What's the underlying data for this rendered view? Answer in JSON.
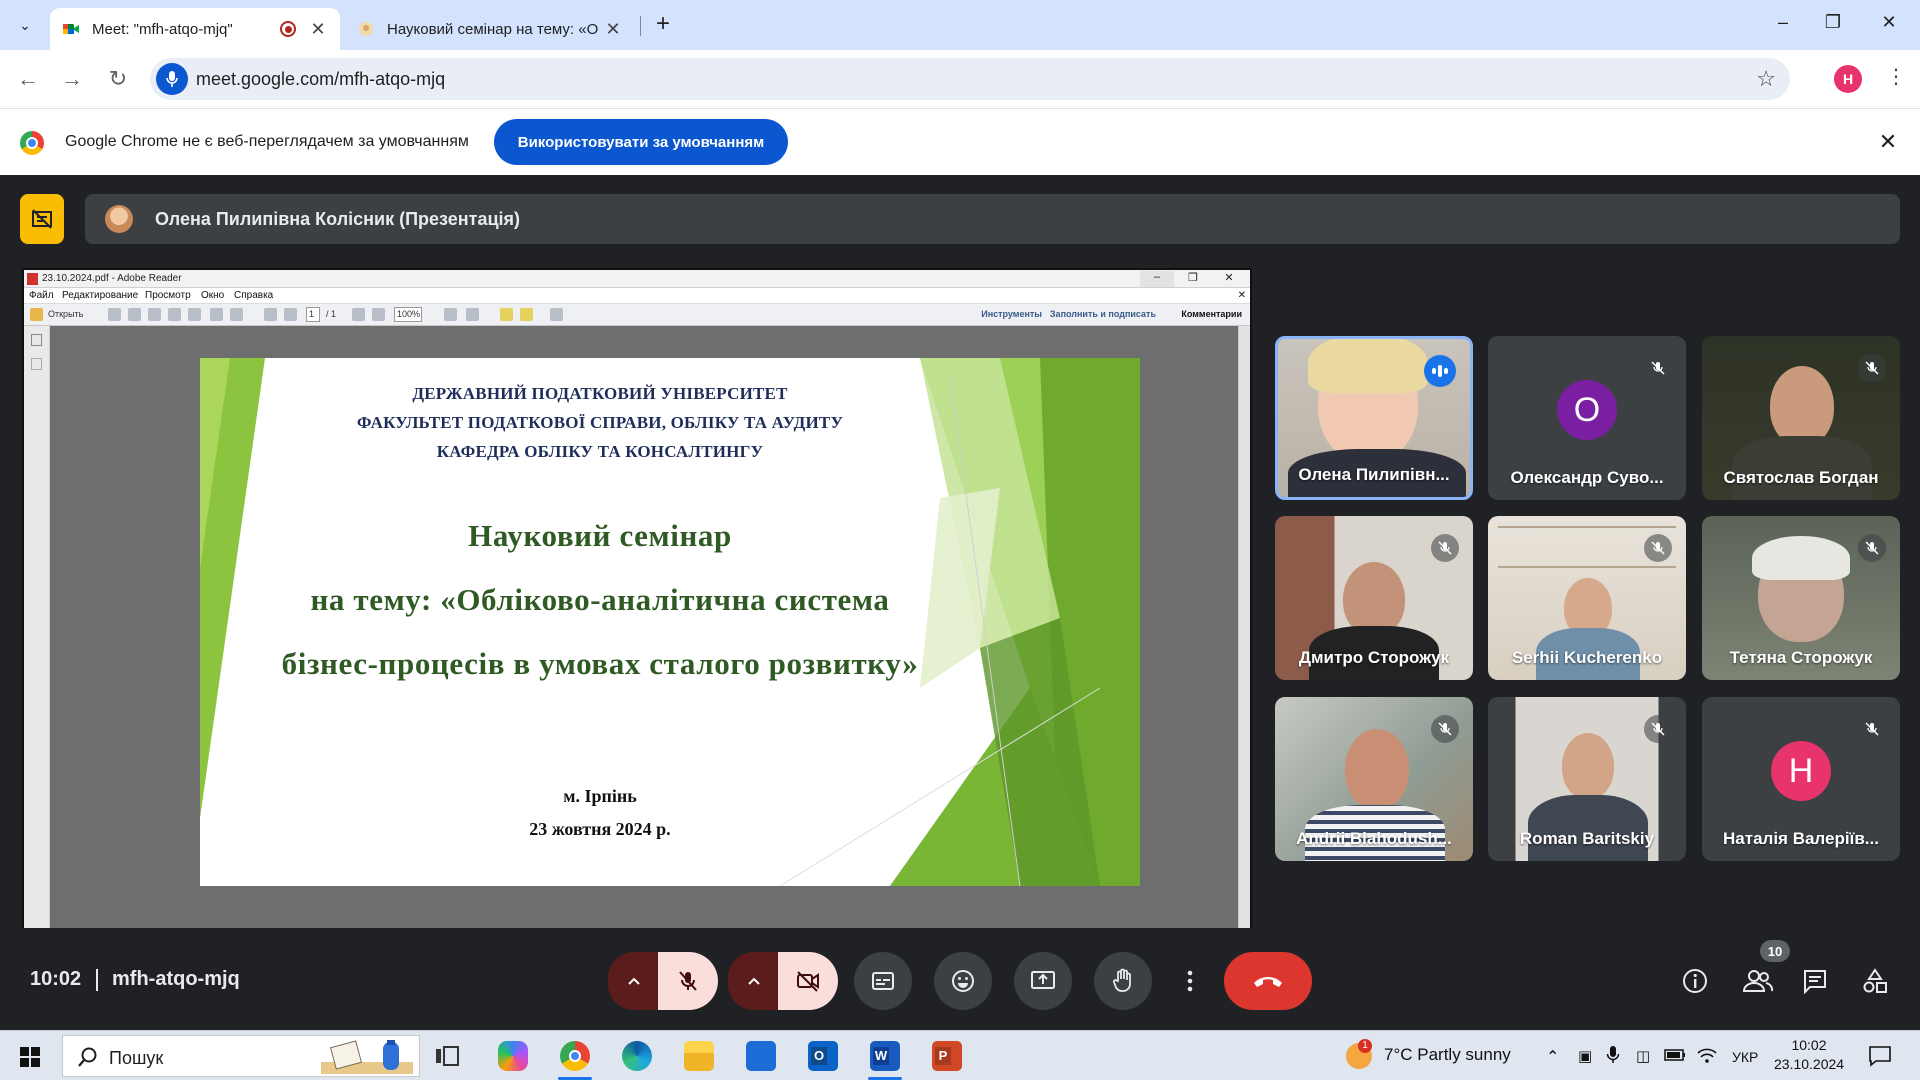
{
  "browser": {
    "tabs": [
      {
        "title": "Meet: \"mfh-atqo-mjq\"",
        "active": true
      },
      {
        "title": "Науковий семінар на тему: «О",
        "active": false
      }
    ],
    "url": "meet.google.com/mfh-atqo-mjq",
    "profile_initial": "H",
    "infobar": {
      "message": "Google Chrome не є веб-переглядачем за умовчанням",
      "button_label": "Використовувати за умовчанням"
    }
  },
  "meet": {
    "presenter_label": "Олена Пилипівна Колісник (Презентація)",
    "clock": "10:02",
    "meeting_code": "mfh-atqo-mjq",
    "participant_count": "10",
    "participants": [
      {
        "name": "Олена Пилипівн...",
        "speaking": true
      },
      {
        "name": "Олександр Суво...",
        "avatar_letter": "O",
        "avatar_color": "#7b1fa2"
      },
      {
        "name": "Святослав Богдан"
      },
      {
        "name": "Дмитро Сторожук"
      },
      {
        "name": "Serhii Kucherenko"
      },
      {
        "name": "Тетяна Сторожук"
      },
      {
        "name": "Andrii Blahodush..."
      },
      {
        "name": "Roman Baritskiy"
      },
      {
        "name": "Наталія Валеріїв...",
        "avatar_letter": "Н",
        "avatar_color": "#e8336c"
      }
    ]
  },
  "reader": {
    "window_title": "23.10.2024.pdf - Adobe Reader",
    "menu": [
      "Файл",
      "Редактирование",
      "Просмотр",
      "Окно",
      "Справка"
    ],
    "open_label": "Открыть",
    "page_current": "1",
    "page_total": "/ 1",
    "zoom": "100%",
    "tool_tabs": [
      "Инструменты",
      "Заполнить и подписать",
      "Комментарии"
    ]
  },
  "slide": {
    "header_lines": [
      "ДЕРЖАВНИЙ ПОДАТКОВИЙ УНІВЕРСИТЕТ",
      "ФАКУЛЬТЕТ ПОДАТКОВОЇ СПРАВИ, ОБЛІКУ ТА АУДИТУ",
      "КАФЕДРА ОБЛІКУ ТА КОНСАЛТИНГУ"
    ],
    "title_lines": [
      "Науковий семінар",
      "на тему: «Обліково-аналітична система",
      "бізнес-процесів в умовах сталого розвитку»"
    ],
    "city": "м. Ірпінь",
    "date": "23 жовтня 2024 р."
  },
  "taskbar": {
    "search_placeholder": "Пошук",
    "weather_badge": "1",
    "weather": "7°C  Partly sunny",
    "language": "УКР",
    "time": "10:02",
    "date": "23.10.2024"
  },
  "colors": {
    "meet_bg": "#202124",
    "tile_bg": "#3c4043",
    "end_call": "#dc362e",
    "chrome_blue": "#0b57d0",
    "present_yellow": "#fbbc04"
  }
}
